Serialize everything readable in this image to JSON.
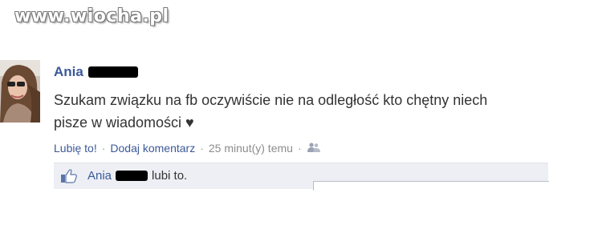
{
  "watermark": {
    "text": "www.wiocha.pl"
  },
  "post": {
    "author": "Ania",
    "message_line1": "Szukam związku na fb oczywiście nie na odległość kto chętny niech",
    "message_line2": "pisze w wiadomości ♥",
    "like_label": "Lubię to!",
    "comment_label": "Dodaj komentarz",
    "timestamp": "25 minut(y) temu",
    "separator": "·",
    "audience_icon": "friends-icon"
  },
  "likes": {
    "icon": "thumbs-up-icon",
    "name": "Ania",
    "suffix": "lubi to."
  }
}
